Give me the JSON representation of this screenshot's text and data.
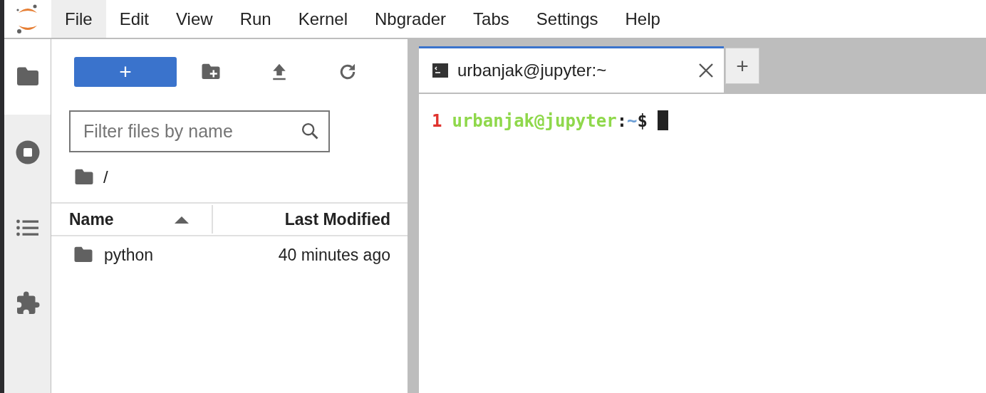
{
  "menu": [
    {
      "label": "File",
      "selected": true
    },
    {
      "label": "Edit",
      "selected": false
    },
    {
      "label": "View",
      "selected": false
    },
    {
      "label": "Run",
      "selected": false
    },
    {
      "label": "Kernel",
      "selected": false
    },
    {
      "label": "Nbgrader",
      "selected": false
    },
    {
      "label": "Tabs",
      "selected": false
    },
    {
      "label": "Settings",
      "selected": false
    },
    {
      "label": "Help",
      "selected": false
    }
  ],
  "activity_bar": [
    {
      "kind": "folder",
      "selected": true
    },
    {
      "kind": "stop",
      "selected": false
    },
    {
      "kind": "list",
      "selected": false
    },
    {
      "kind": "puzzle",
      "selected": false
    }
  ],
  "file_browser": {
    "new_button": {
      "label": "+"
    },
    "filter": {
      "placeholder": "Filter files by name"
    },
    "breadcrumb": "/",
    "columns": [
      {
        "label": "Name",
        "sorted": true
      },
      {
        "label": "Last Modified",
        "sorted": false
      }
    ],
    "rows": [
      {
        "kind": "folder",
        "name": "python",
        "modified": "40 minutes ago"
      }
    ]
  },
  "tabs": [
    {
      "title": "urbanjak@jupyter:~",
      "selected": true
    }
  ],
  "new_tab_button": "+",
  "terminal": {
    "lines": [
      [
        {
          "kind": "line_number",
          "text": "1"
        },
        {
          "kind": "user_host",
          "text": "urbanjak@jupyter"
        },
        {
          "kind": "plain",
          "text": ":"
        },
        {
          "kind": "path",
          "text": "~"
        },
        {
          "kind": "plain",
          "text": "$"
        }
      ]
    ],
    "cursor": true
  }
}
